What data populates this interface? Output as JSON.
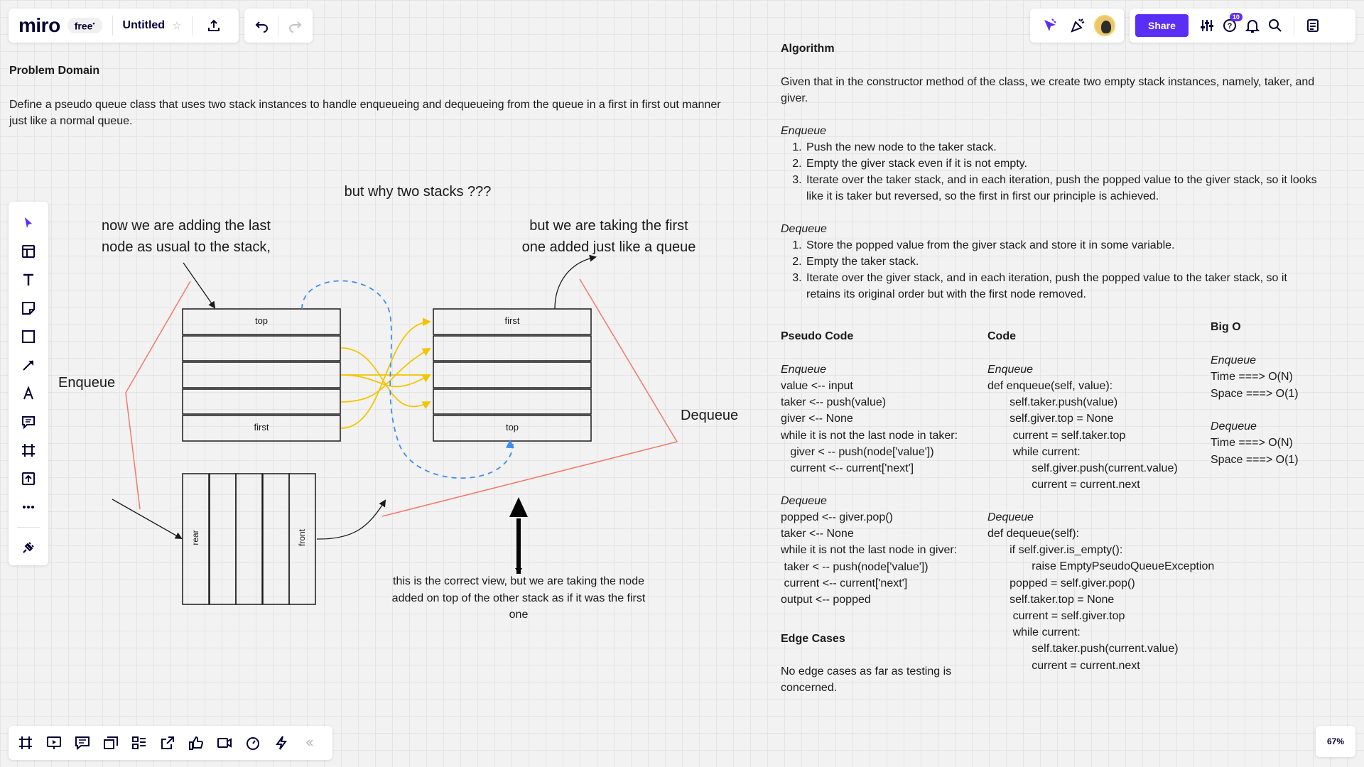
{
  "app": {
    "logo": "miro",
    "plan": "free",
    "plan_marker": "•",
    "board_title": "Untitled",
    "share_label": "Share",
    "notifications_count": "10",
    "zoom": "67%"
  },
  "colors": {
    "accent": "#5b2ef5",
    "yellow_arrows": "#f2c500",
    "blue_dashed": "#3d8ef0",
    "red_lines": "#f07a6a"
  },
  "left_toolbar": [
    "select-icon",
    "templates-icon",
    "text-icon",
    "sticky-note-icon",
    "shape-icon",
    "connection-line-icon",
    "pen-icon",
    "comment-icon",
    "frame-icon",
    "upload-icon",
    "more-icon",
    "apps-icon"
  ],
  "bottom_toolbar": [
    "frames-icon",
    "presentation-icon",
    "comments-icon",
    "cards-icon",
    "kanban-icon",
    "share-screen-icon",
    "reactions-icon",
    "video-icon",
    "timer-icon",
    "lightning-icon",
    "collapse-icon"
  ],
  "problem": {
    "title": "Problem Domain",
    "body": "Define a pseudo queue class that uses two stack instances to handle enqueueing and dequeueing from the queue in a first in first out manner just like a normal queue."
  },
  "diagram": {
    "why_label": "but why two stacks ???",
    "adding_label_1": "now we are adding the last",
    "adding_label_2": "node as usual to the stack,",
    "taking_label_1": "but we are taking the first",
    "taking_label_2": "one added just like a queue",
    "enqueue_label": "Enqueue",
    "dequeue_label": "Dequeue",
    "left_stack_top": "top",
    "left_stack_bottom": "first",
    "right_stack_top": "first",
    "right_stack_bottom": "top",
    "queue_rear": "rear",
    "queue_front": "front",
    "correct_view_1": "this is the correct view, but we are taking the node",
    "correct_view_2": "added on top of the other stack as if it was the first",
    "correct_view_3": "one"
  },
  "algorithm": {
    "title": "Algorithm",
    "intro_1": "Given that in the constructor method of the class, we create two empty stack instances, namely, taker, and",
    "intro_2": "giver.",
    "enqueue_title": "Enqueue",
    "enqueue_steps": [
      "Push the new node to the taker stack.",
      "Empty the giver stack even if it is not empty.",
      "Iterate over the taker stack, and in each iteration, push the popped value to the giver stack, so it looks",
      "like it is taker but reversed, so the first in first our principle is achieved."
    ],
    "dequeue_title": "Dequeue",
    "dequeue_steps": [
      "Store the popped value from the giver stack and store it in some variable.",
      "Empty the taker stack.",
      "Iterate over the giver stack, and in each iteration, push the popped value to the taker stack, so it",
      "retains its original order but with the first node removed."
    ]
  },
  "pseudo": {
    "title": "Pseudo Code",
    "enqueue_title": "Enqueue",
    "enqueue_lines": [
      "value <-- input",
      "taker <-- push(value)",
      "giver <-- None",
      "while it is not the last node in taker:",
      "   giver < -- push(node['value'])",
      "   current <-- current['next']"
    ],
    "dequeue_title": "Dequeue",
    "dequeue_lines": [
      "popped <-- giver.pop()",
      "taker <-- None",
      "while it is not the last node in giver:",
      " taker < -- push(node['value'])",
      " current <-- current['next']",
      "output <-- popped"
    ]
  },
  "code": {
    "title": "Code",
    "enqueue_title": "Enqueue",
    "enqueue_lines": [
      "def enqueue(self, value):",
      "       self.taker.push(value)",
      "       self.giver.top = None",
      "        current = self.taker.top",
      "        while current:",
      "              self.giver.push(current.value)",
      "              current = current.next"
    ],
    "dequeue_title": "Dequeue",
    "dequeue_lines": [
      "def dequeue(self):",
      "       if self.giver.is_empty():",
      "              raise EmptyPseudoQueueException",
      "       popped = self.giver.pop()",
      "       self.taker.top = None",
      "        current = self.giver.top",
      "        while current:",
      "              self.taker.push(current.value)",
      "              current = current.next"
    ]
  },
  "bigo": {
    "title": "Big O",
    "enqueue_title": "Enqueue",
    "enqueue_time": "Time ===> O(N)",
    "enqueue_space": "Space ===> O(1)",
    "dequeue_title": "Dequeue",
    "dequeue_time": "Time ===> O(N)",
    "dequeue_space": "Space ===> O(1)"
  },
  "edge": {
    "title": "Edge Cases",
    "line_1": "No edge cases as far as testing is",
    "line_2": "concerned."
  }
}
